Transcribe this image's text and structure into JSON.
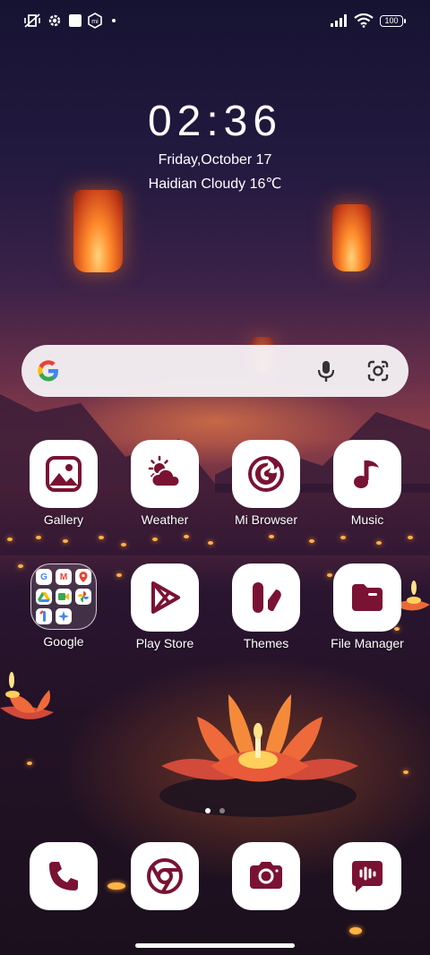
{
  "status_bar": {
    "icons": [
      "vibrate-icon",
      "settings-gear-icon",
      "square-notification-icon",
      "mi-icon",
      "dot-icon",
      "signal-icon",
      "wifi-icon",
      "battery-icon"
    ],
    "battery": "100"
  },
  "lockscreen": {
    "time": "02:36",
    "date": "Friday,October 17",
    "weather": "Haidian Cloudy 16℃"
  },
  "search": {
    "icons": [
      "google-g-icon",
      "microphone-icon",
      "google-lens-icon"
    ]
  },
  "apps": [
    {
      "label": "Gallery",
      "icon": "gallery-icon"
    },
    {
      "label": "Weather",
      "icon": "weather-icon"
    },
    {
      "label": "Mi Browser",
      "icon": "mi-browser-icon"
    },
    {
      "label": "Music",
      "icon": "music-note-icon"
    },
    {
      "label": "Google",
      "icon": "folder-icon"
    },
    {
      "label": "Play Store",
      "icon": "play-store-icon"
    },
    {
      "label": "Themes",
      "icon": "themes-icon"
    },
    {
      "label": "File Manager",
      "icon": "file-manager-icon"
    }
  ],
  "folder_apps": [
    "G",
    "M",
    "maps",
    "drive",
    "meet",
    "photos",
    "one",
    "assistant"
  ],
  "dock": [
    {
      "icon": "phone-icon"
    },
    {
      "icon": "chrome-icon"
    },
    {
      "icon": "camera-icon"
    },
    {
      "icon": "messages-icon"
    }
  ],
  "page_indicator": {
    "pages": 2,
    "current": 1
  },
  "colors": {
    "icon_glyph": "#7a1233",
    "search_bg": "#f3f0f4"
  }
}
